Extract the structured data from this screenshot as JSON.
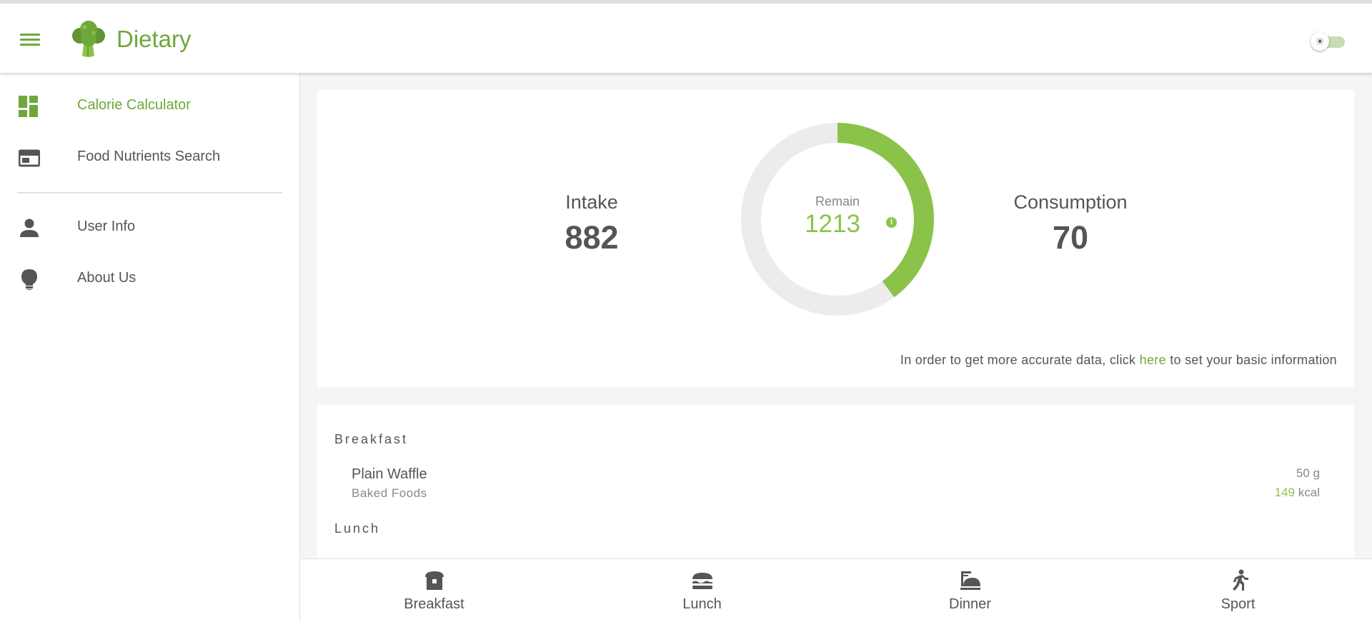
{
  "app": {
    "title": "Dietary",
    "theme_toggle_icon": "sun-icon"
  },
  "colors": {
    "accent": "#6fa83a",
    "ring": "#8bc34a",
    "ring_track": "#ececec"
  },
  "sidebar": {
    "items": [
      {
        "label": "Calorie Calculator",
        "icon": "dashboard-icon",
        "active": true
      },
      {
        "label": "Food Nutrients Search",
        "icon": "table-icon",
        "active": false
      },
      {
        "label": "User Info",
        "icon": "person-icon",
        "active": false
      },
      {
        "label": "About Us",
        "icon": "lightbulb-icon",
        "active": false
      }
    ]
  },
  "summary": {
    "intake_label": "Intake",
    "intake_value": "882",
    "remain_label": "Remain",
    "remain_value": "1213",
    "remain_progress": 0.4,
    "consumption_label": "Consumption",
    "consumption_value": "70",
    "hint_before": "In order to get more accurate data, click ",
    "hint_link": "here",
    "hint_after": " to set your basic information"
  },
  "meals": {
    "breakfast_header": "Breakfast",
    "lunch_header": "Lunch",
    "breakfast_items": [
      {
        "name": "Plain Waffle",
        "category": "Baked Foods",
        "amount": "50 g",
        "kcal": "149",
        "kcal_unit": "kcal"
      }
    ]
  },
  "bottom_nav": {
    "items": [
      {
        "label": "Breakfast",
        "icon": "bread-icon"
      },
      {
        "label": "Lunch",
        "icon": "burger-icon"
      },
      {
        "label": "Dinner",
        "icon": "dinner-icon"
      },
      {
        "label": "Sport",
        "icon": "running-icon"
      }
    ]
  }
}
